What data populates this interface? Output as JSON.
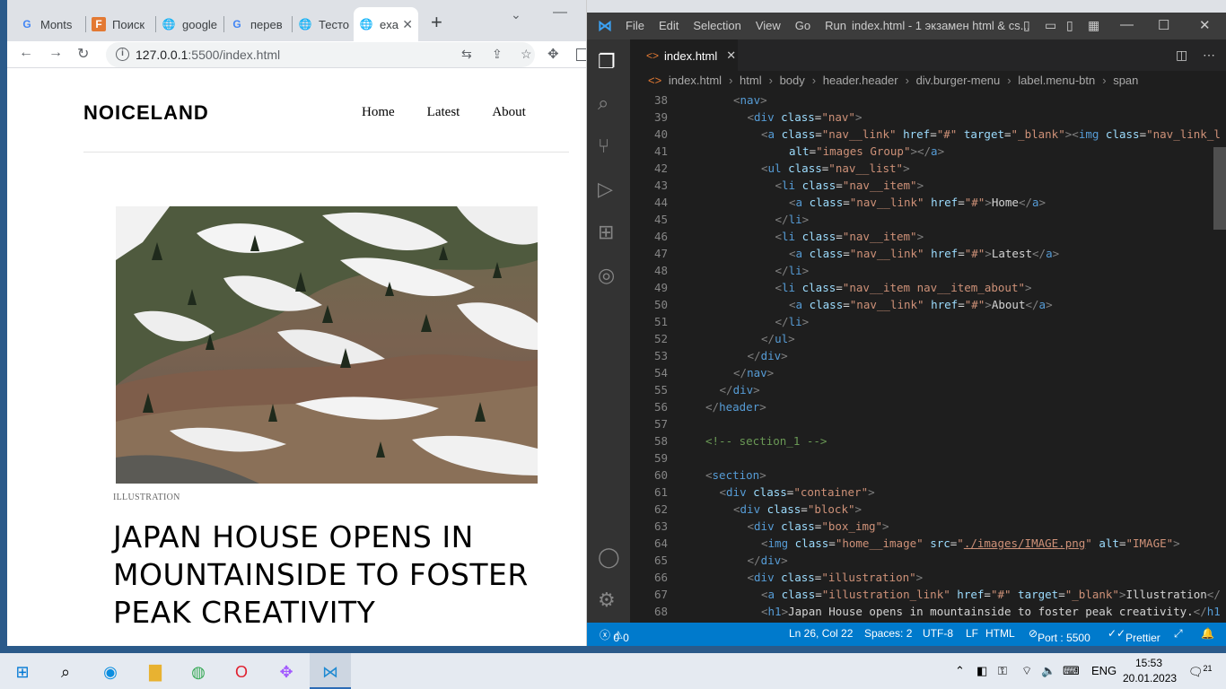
{
  "browser": {
    "tabs": [
      {
        "label": "Monts",
        "favicon": "google-g"
      },
      {
        "label": "Поиск",
        "favicon": "figma-f"
      },
      {
        "label": "google",
        "favicon": "globe"
      },
      {
        "label": "перев",
        "favicon": "google-g"
      },
      {
        "label": "Тесто",
        "favicon": "globe"
      },
      {
        "label": "exa",
        "favicon": "globe",
        "active": true
      }
    ],
    "url_host": "127.0.0.1",
    "url_path": ":5500/index.html"
  },
  "site": {
    "logo": "NOICELAND",
    "nav": [
      "Home",
      "Latest",
      "About"
    ],
    "category": "ILLUSTRATION",
    "headline": "JAPAN HOUSE OPENS IN MOUNTAINSIDE TO FOSTER PEAK CREATIVITY"
  },
  "vscode": {
    "menu": [
      "File",
      "Edit",
      "Selection",
      "View",
      "Go",
      "Run"
    ],
    "title": "index.html - 1 экзамен html & cs...",
    "open_tab": "index.html",
    "breadcrumbs": [
      "index.html",
      "html",
      "body",
      "header.header",
      "div.burger-menu",
      "label.menu-btn",
      "span"
    ],
    "lines": [
      {
        "n": "38",
        "html": "<span class='p'>&lt;</span><span class='t'>nav</span><span class='p'>&gt;</span>",
        "indent": 2
      },
      {
        "n": "39",
        "html": "<span class='p'>&lt;</span><span class='t'>div</span> <span class='a'>class</span><span class='w'>=</span><span class='s'>\"nav\"</span><span class='p'>&gt;</span>",
        "indent": 3
      },
      {
        "n": "40",
        "html": "<span class='p'>&lt;</span><span class='t'>a</span> <span class='a'>class</span><span class='w'>=</span><span class='s'>\"nav__link\"</span> <span class='a'>href</span><span class='w'>=</span><span class='s'>\"#\"</span> <span class='a'>target</span><span class='w'>=</span><span class='s'>\"_blank\"</span><span class='p'>&gt;&lt;</span><span class='t'>img</span> <span class='a'>class</span><span class='w'>=</span><span class='s'>\"nav_link_l</span>",
        "indent": 4
      },
      {
        "n": "41",
        "html": "<span class='a'>alt</span><span class='w'>=</span><span class='s'>\"images Group\"</span><span class='p'>&gt;&lt;/</span><span class='t'>a</span><span class='p'>&gt;</span>",
        "indent": 6
      },
      {
        "n": "42",
        "html": "<span class='p'>&lt;</span><span class='t'>ul</span> <span class='a'>class</span><span class='w'>=</span><span class='s'>\"nav__list\"</span><span class='p'>&gt;</span>",
        "indent": 4
      },
      {
        "n": "43",
        "html": "<span class='p'>&lt;</span><span class='t'>li</span> <span class='a'>class</span><span class='w'>=</span><span class='s'>\"nav__item\"</span><span class='p'>&gt;</span>",
        "indent": 5
      },
      {
        "n": "44",
        "html": "<span class='p'>&lt;</span><span class='t'>a</span> <span class='a'>class</span><span class='w'>=</span><span class='s'>\"nav__link\"</span> <span class='a'>href</span><span class='w'>=</span><span class='s'>\"#\"</span><span class='p'>&gt;</span><span class='w'>Home</span><span class='p'>&lt;/</span><span class='t'>a</span><span class='p'>&gt;</span>",
        "indent": 6
      },
      {
        "n": "45",
        "html": "<span class='p'>&lt;/</span><span class='t'>li</span><span class='p'>&gt;</span>",
        "indent": 5
      },
      {
        "n": "46",
        "html": "<span class='p'>&lt;</span><span class='t'>li</span> <span class='a'>class</span><span class='w'>=</span><span class='s'>\"nav__item\"</span><span class='p'>&gt;</span>",
        "indent": 5
      },
      {
        "n": "47",
        "html": "<span class='p'>&lt;</span><span class='t'>a</span> <span class='a'>class</span><span class='w'>=</span><span class='s'>\"nav__link\"</span> <span class='a'>href</span><span class='w'>=</span><span class='s'>\"#\"</span><span class='p'>&gt;</span><span class='w'>Latest</span><span class='p'>&lt;/</span><span class='t'>a</span><span class='p'>&gt;</span>",
        "indent": 6
      },
      {
        "n": "48",
        "html": "<span class='p'>&lt;/</span><span class='t'>li</span><span class='p'>&gt;</span>",
        "indent": 5
      },
      {
        "n": "49",
        "html": "<span class='p'>&lt;</span><span class='t'>li</span> <span class='a'>class</span><span class='w'>=</span><span class='s'>\"nav__item nav__item_about\"</span><span class='p'>&gt;</span>",
        "indent": 5
      },
      {
        "n": "50",
        "html": "<span class='p'>&lt;</span><span class='t'>a</span> <span class='a'>class</span><span class='w'>=</span><span class='s'>\"nav__link\"</span> <span class='a'>href</span><span class='w'>=</span><span class='s'>\"#\"</span><span class='p'>&gt;</span><span class='w'>About</span><span class='p'>&lt;/</span><span class='t'>a</span><span class='p'>&gt;</span>",
        "indent": 6
      },
      {
        "n": "51",
        "html": "<span class='p'>&lt;/</span><span class='t'>li</span><span class='p'>&gt;</span>",
        "indent": 5
      },
      {
        "n": "52",
        "html": "<span class='p'>&lt;/</span><span class='t'>ul</span><span class='p'>&gt;</span>",
        "indent": 4
      },
      {
        "n": "53",
        "html": "<span class='p'>&lt;/</span><span class='t'>div</span><span class='p'>&gt;</span>",
        "indent": 3
      },
      {
        "n": "54",
        "html": "<span class='p'>&lt;/</span><span class='t'>nav</span><span class='p'>&gt;</span>",
        "indent": 2
      },
      {
        "n": "55",
        "html": "<span class='p'>&lt;/</span><span class='t'>div</span><span class='p'>&gt;</span>",
        "indent": 1
      },
      {
        "n": "56",
        "html": "<span class='p'>&lt;/</span><span class='t'>header</span><span class='p'>&gt;</span>",
        "indent": 0
      },
      {
        "n": "57",
        "html": "",
        "indent": 0
      },
      {
        "n": "58",
        "html": "<span class='c'>&lt;!-- section_1 --&gt;</span>",
        "indent": 0
      },
      {
        "n": "59",
        "html": "",
        "indent": 0
      },
      {
        "n": "60",
        "html": "<span class='p'>&lt;</span><span class='t'>section</span><span class='p'>&gt;</span>",
        "indent": 0
      },
      {
        "n": "61",
        "html": "<span class='p'>&lt;</span><span class='t'>div</span> <span class='a'>class</span><span class='w'>=</span><span class='s'>\"container\"</span><span class='p'>&gt;</span>",
        "indent": 1
      },
      {
        "n": "62",
        "html": "<span class='p'>&lt;</span><span class='t'>div</span> <span class='a'>class</span><span class='w'>=</span><span class='s'>\"block\"</span><span class='p'>&gt;</span>",
        "indent": 2
      },
      {
        "n": "63",
        "html": "<span class='p'>&lt;</span><span class='t'>div</span> <span class='a'>class</span><span class='w'>=</span><span class='s'>\"box_img\"</span><span class='p'>&gt;</span>",
        "indent": 3
      },
      {
        "n": "64",
        "html": "<span class='p'>&lt;</span><span class='t'>img</span> <span class='a'>class</span><span class='w'>=</span><span class='s'>\"home__image\"</span> <span class='a'>src</span><span class='w'>=</span><span class='s'>\"<u>./images/IMAGE.png</u>\"</span> <span class='a'>alt</span><span class='w'>=</span><span class='s'>\"IMAGE\"</span><span class='p'>&gt;</span>",
        "indent": 4
      },
      {
        "n": "65",
        "html": "<span class='p'>&lt;/</span><span class='t'>div</span><span class='p'>&gt;</span>",
        "indent": 3
      },
      {
        "n": "66",
        "html": "<span class='p'>&lt;</span><span class='t'>div</span> <span class='a'>class</span><span class='w'>=</span><span class='s'>\"illustration\"</span><span class='p'>&gt;</span>",
        "indent": 3
      },
      {
        "n": "67",
        "html": "<span class='p'>&lt;</span><span class='t'>a</span> <span class='a'>class</span><span class='w'>=</span><span class='s'>\"illustration_link\"</span> <span class='a'>href</span><span class='w'>=</span><span class='s'>\"#\"</span> <span class='a'>target</span><span class='w'>=</span><span class='s'>\"_blank\"</span><span class='p'>&gt;</span><span class='w'>Illustration</span><span class='p'>&lt;/</span>",
        "indent": 4
      },
      {
        "n": "68",
        "html": "<span class='p'>&lt;</span><span class='t'>h1</span><span class='p'>&gt;</span><span class='w'>Japan House opens in mountainside to foster peak creativity.</span><span class='p'>&lt;/</span><span class='t'>h1</span>",
        "indent": 4
      }
    ],
    "status": {
      "errors": "0",
      "warnings": "0",
      "position": "Ln 26, Col 22",
      "spaces": "Spaces: 2",
      "encoding": "UTF-8",
      "eol": "LF",
      "language": "HTML",
      "port": "Port : 5500",
      "formatter": "Prettier"
    }
  },
  "taskbar": {
    "lang": "ENG",
    "time": "15:53",
    "date": "20.01.2023",
    "notifications": "21"
  }
}
